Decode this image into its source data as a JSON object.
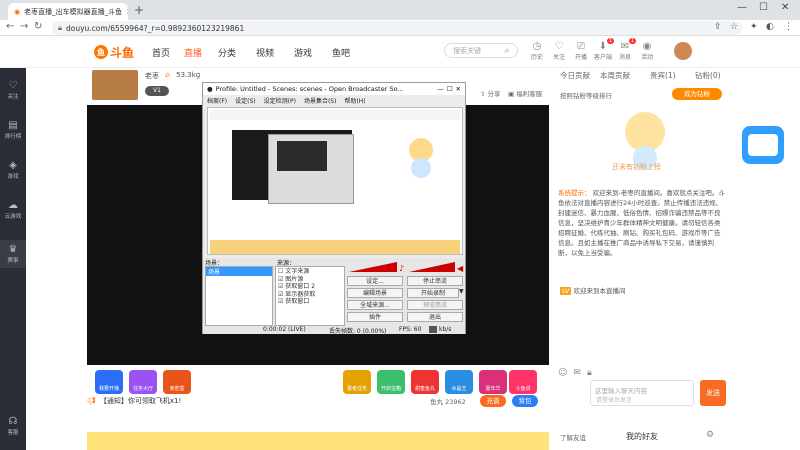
{
  "browser": {
    "tab_title": "老枣直播_出车模拟器直播_斗鱼",
    "url": "douyu.com/6559964?_r=0.9892360123219861"
  },
  "header": {
    "nav": [
      "首页",
      "直播",
      "分类",
      "视频",
      "游戏",
      "鱼吧"
    ],
    "search_placeholder": "搜索关键",
    "icons": [
      "历史",
      "关注",
      "开播",
      "客户端",
      "消息",
      "下载",
      "活动"
    ]
  },
  "sidebar": {
    "items": [
      "关注",
      "排行榜",
      "游戏",
      "云游戏",
      "赛事",
      "客服"
    ]
  },
  "room": {
    "streamer": "老枣",
    "viewers": "53.3kg",
    "v_badge": "V1",
    "share": "分享",
    "follow_help": "福利客服"
  },
  "obs": {
    "title": "Profile: Untitled - Scenes: scenes - Open Broadcaster So...",
    "menus": [
      "档案(F)",
      "设定(S)",
      "设定检测(P)",
      "场景集合(S)",
      "帮助(H)"
    ],
    "scenes_label": "场景：",
    "scenes": [
      "场景"
    ],
    "sources_label": "来源：",
    "sources": [
      "文字来源",
      "图片源",
      "获取窗口 2",
      "显示器获取",
      "获取窗口"
    ],
    "buttons": [
      "设定...",
      "停止串流",
      "编辑场景",
      "开始录制",
      "全域来源...",
      "预览串流",
      "插件",
      "退出"
    ],
    "status_time": "0:00:02 (LIVE)",
    "status_dropped": "丢失帧数: 0 (0.00%)",
    "status_fps": "FPS: 60",
    "status_kbps": "kb/s"
  },
  "gifts": [
    {
      "label": "我要开播",
      "color": "#2d6df6"
    },
    {
      "label": "任务大厅",
      "color": "#9a53f2"
    },
    {
      "label": "亲密盒",
      "color": "#e8551b"
    },
    {
      "label": "勇者任务",
      "color": "#e5a100"
    },
    {
      "label": "开启宝箱",
      "color": "#3cbf6d"
    },
    {
      "label": "甜蜜鱼丸",
      "color": "#e33"
    },
    {
      "label": "水晶王",
      "color": "#2a8fe3"
    },
    {
      "label": "嘉年华",
      "color": "#d9307a"
    },
    {
      "label": "斗鱼说",
      "color": "#f36"
    }
  ],
  "gift_notice": "【通知】你可领取飞机x1!",
  "fan_info": "鱼丸 23962",
  "gift_buttons": [
    "充值",
    "背包"
  ],
  "right_panel": {
    "tabs": [
      "今日贡献",
      "本周贡献",
      "贵宾(1)",
      "钻粉(0)"
    ],
    "rank_text": "按照钻粉等级排行",
    "rank_btn": "成为钻粉",
    "empty_caption": "还未有钻粉上榜",
    "system_label": "系统提示：",
    "system_msg": "欢迎来到-老枣的直播间。喜欢就点关注吧。斗鱼依法对直播内容进行24小时巡查。禁止传播违法违规、封建迷信、暴力血腥、低俗色情、招嫖诈骗违禁品等不良信息，坚决维护青少年群体精神文明健康。请勿轻信各类招聘征婚、代练代抽、刷钻、购买礼包码、游戏币等广告信息。且如主播在推广商品中诱导私下交易，请谨慎判断，以免上当受骗。",
    "welcome": "欢迎来到本直播间",
    "chat_placeholder": "这里输入聊天内容",
    "send": "发送",
    "login_hint": "请登录后发言",
    "friends": "我的好友",
    "friends_left": "了解友谊"
  }
}
